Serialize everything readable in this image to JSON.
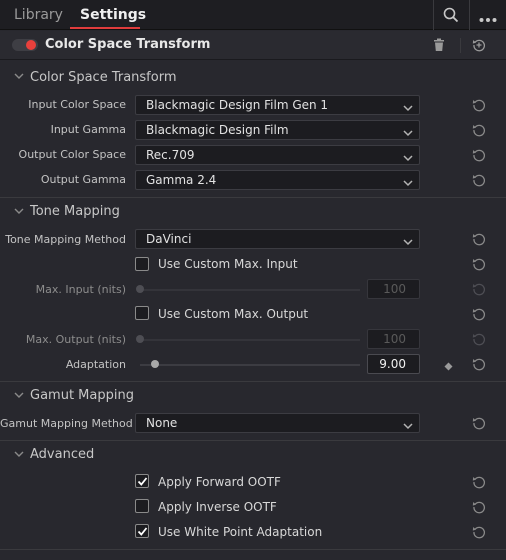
{
  "tabs": [
    {
      "label": "Library"
    },
    {
      "label": "Settings"
    }
  ],
  "effect": {
    "title": "Color Space Transform",
    "enabled": true
  },
  "sections": {
    "csT": "Color Space Transform",
    "tone": "Tone Mapping",
    "gamut": "Gamut Mapping",
    "advanced": "Advanced"
  },
  "csT_fields": [
    {
      "label": "Input Color Space",
      "value": "Blackmagic Design Film Gen 1"
    },
    {
      "label": "Input Gamma",
      "value": "Blackmagic Design Film"
    },
    {
      "label": "Output Color Space",
      "value": "Rec.709"
    },
    {
      "label": "Output Gamma",
      "value": "Gamma 2.4"
    }
  ],
  "tone": {
    "method_label": "Tone Mapping Method",
    "method_value": "DaVinci",
    "custom_max_input": {
      "label": "Use Custom Max. Input",
      "checked": false
    },
    "max_input": {
      "label": "Max. Input (nits)",
      "value": "100"
    },
    "custom_max_output": {
      "label": "Use Custom Max. Output",
      "checked": false
    },
    "max_output": {
      "label": "Max. Output (nits)",
      "value": "100"
    },
    "adaptation": {
      "label": "Adaptation",
      "value": "9.00",
      "fraction": 0.05
    }
  },
  "gamut": {
    "method_label": "Gamut Mapping Method",
    "method_value": "None"
  },
  "advanced": [
    {
      "label": "Apply Forward OOTF",
      "checked": true
    },
    {
      "label": "Apply Inverse OOTF",
      "checked": false
    },
    {
      "label": "Use White Point Adaptation",
      "checked": true
    }
  ],
  "colors": {
    "accent": "#e03c3c",
    "background": "#28282e"
  },
  "icons": [
    "search-icon",
    "more-icon",
    "trash-icon",
    "reset-all-icon",
    "reset-icon",
    "chevron-down-icon",
    "keyframe-icon",
    "checkmark-icon"
  ]
}
